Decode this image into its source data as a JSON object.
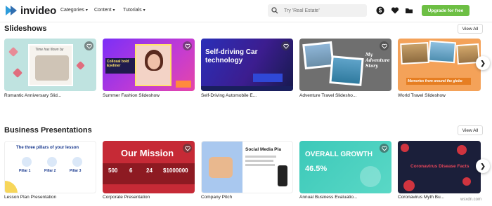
{
  "header": {
    "logo_text": "invideo",
    "nav": [
      {
        "label": "Categories"
      },
      {
        "label": "Content"
      },
      {
        "label": "Tutorials"
      }
    ],
    "search_placeholder": "Try 'Real Estate'",
    "upgrade_label": "Upgrade for free",
    "brand_color": "#6dbf44"
  },
  "sections": [
    {
      "title": "Slideshows",
      "view_all": "View All",
      "cards": [
        {
          "label": "Romantic Anniversary Slid...",
          "thumb_text": "Time has flown by"
        },
        {
          "label": "Summer Fashion Slideshow",
          "thumb_text": "Collosal bold Eyeliner"
        },
        {
          "label": "Self-Driving Automobile E...",
          "thumb_text": "Self-driving Car technology"
        },
        {
          "label": "Adventure Travel Slidesho...",
          "thumb_text": "My Adventure Story"
        },
        {
          "label": "World Travel Slideshow",
          "thumb_text": "Memories from around the globe"
        }
      ]
    },
    {
      "title": "Business Presentations",
      "view_all": "View All",
      "cards": [
        {
          "label": "Lesson Plan Presentation",
          "thumb_text": "The three pillars of your lesson",
          "pillars": [
            "Pillar 1",
            "Pillar 2",
            "Pillar 3"
          ]
        },
        {
          "label": "Corporate Presentation",
          "thumb_text": "Our Mission",
          "stats": [
            "500",
            "6",
            "24",
            "$1000000"
          ]
        },
        {
          "label": "Company Pitch",
          "thumb_text": "Social Media Pla"
        },
        {
          "label": "Annual Business Evaluatio...",
          "thumb_text": "OVERALL GROWTH",
          "stat": "46.5%"
        },
        {
          "label": "Coronavirus Myth Bu...",
          "thumb_text": "Coronavirus Disease Facts"
        }
      ]
    }
  ],
  "watermark": "wsxdn.com"
}
